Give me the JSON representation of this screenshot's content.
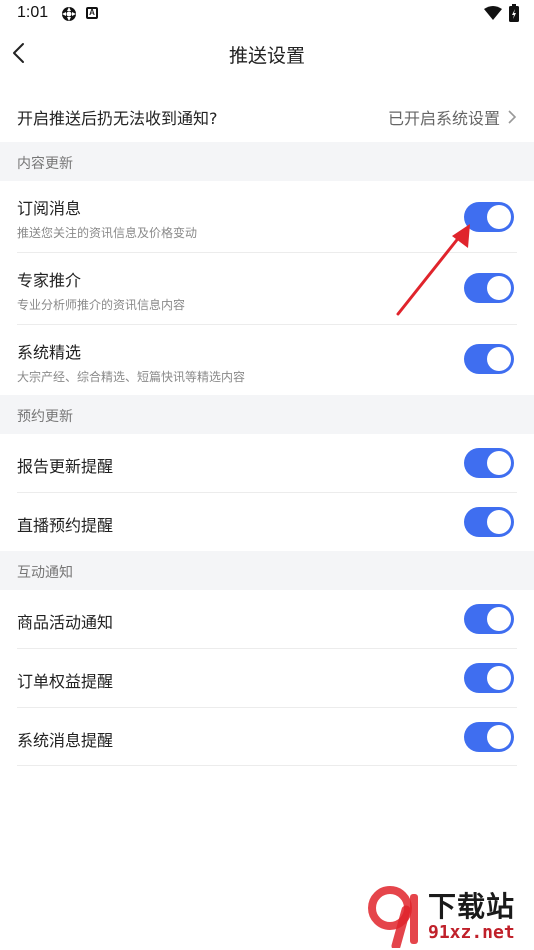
{
  "status_bar": {
    "time": "1:01",
    "icon_b": "A"
  },
  "nav": {
    "title": "推送设置"
  },
  "notice": {
    "question": "开启推送后扔无法收到通知?",
    "link": "已开启系统设置"
  },
  "sections": [
    {
      "title": "内容更新",
      "items": [
        {
          "label": "订阅消息",
          "desc": "推送您关注的资讯信息及价格变动",
          "enabled": true
        },
        {
          "label": "专家推介",
          "desc": "专业分析师推介的资讯信息内容",
          "enabled": true
        },
        {
          "label": "系统精选",
          "desc": "大宗产经、综合精选、短篇快讯等精选内容",
          "enabled": true
        }
      ]
    },
    {
      "title": "预约更新",
      "items": [
        {
          "label": "报告更新提醒",
          "enabled": true
        },
        {
          "label": "直播预约提醒",
          "enabled": true
        }
      ]
    },
    {
      "title": "互动通知",
      "items": [
        {
          "label": "商品活动通知",
          "enabled": true
        },
        {
          "label": "订单权益提醒",
          "enabled": true
        },
        {
          "label": "系统消息提醒",
          "enabled": true
        }
      ]
    }
  ],
  "colors": {
    "accent": "#3f6ef0",
    "section_bg": "#f4f5f7",
    "annotation": "#e0242c"
  },
  "watermark": {
    "brand": "下载站",
    "url": "91xz.net"
  }
}
